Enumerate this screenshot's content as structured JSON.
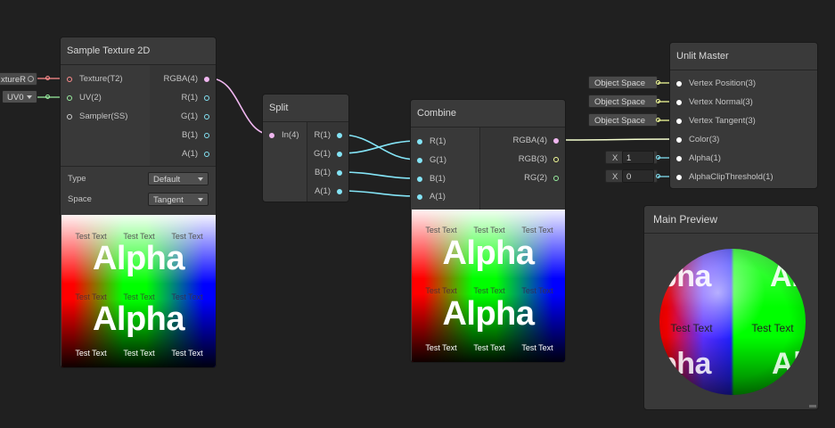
{
  "colors": {
    "vector4": "#f0b7f0",
    "vector2": "#9aefa0",
    "sampler": "#cfcfcf",
    "texture": "#ff8c8c",
    "vector1": "#84e4f6",
    "vector3": "#f6ff9a",
    "background": "#202020",
    "node": "#393939"
  },
  "sample_texture": {
    "title": "Sample Texture 2D",
    "inputs": [
      "Texture(T2)",
      "UV(2)",
      "Sampler(SS)"
    ],
    "outputs": [
      "RGBA(4)",
      "R(1)",
      "G(1)",
      "B(1)",
      "A(1)"
    ],
    "type_label": "Type",
    "type_value": "Default",
    "space_label": "Space",
    "space_value": "Tangent",
    "external_texture": "xtureR",
    "external_uv": "UV0"
  },
  "split": {
    "title": "Split",
    "inputs": [
      "In(4)"
    ],
    "outputs": [
      "R(1)",
      "G(1)",
      "B(1)",
      "A(1)"
    ]
  },
  "combine": {
    "title": "Combine",
    "inputs": [
      "R(1)",
      "G(1)",
      "B(1)",
      "A(1)"
    ],
    "outputs": [
      "RGBA(4)",
      "RGB(3)",
      "RG(2)"
    ]
  },
  "unlit_master": {
    "title": "Unlit Master",
    "inputs": [
      "Vertex Position(3)",
      "Vertex Normal(3)",
      "Vertex Tangent(3)",
      "Color(3)",
      "Alpha(1)",
      "AlphaClipThreshold(1)"
    ],
    "object_space_pills": [
      "Object Space",
      "Object Space",
      "Object Space"
    ],
    "alpha_x_label": "X",
    "alpha_value": "1",
    "clip_x_label": "X",
    "clip_value": "0"
  },
  "main_preview": {
    "title": "Main Preview",
    "sphere_text_left": "Test Text",
    "sphere_text_right": "Test Text",
    "sphere_alpha": "Alpha"
  },
  "preview_texture": {
    "small_text": "Test Text",
    "big_text": "Alpha"
  }
}
